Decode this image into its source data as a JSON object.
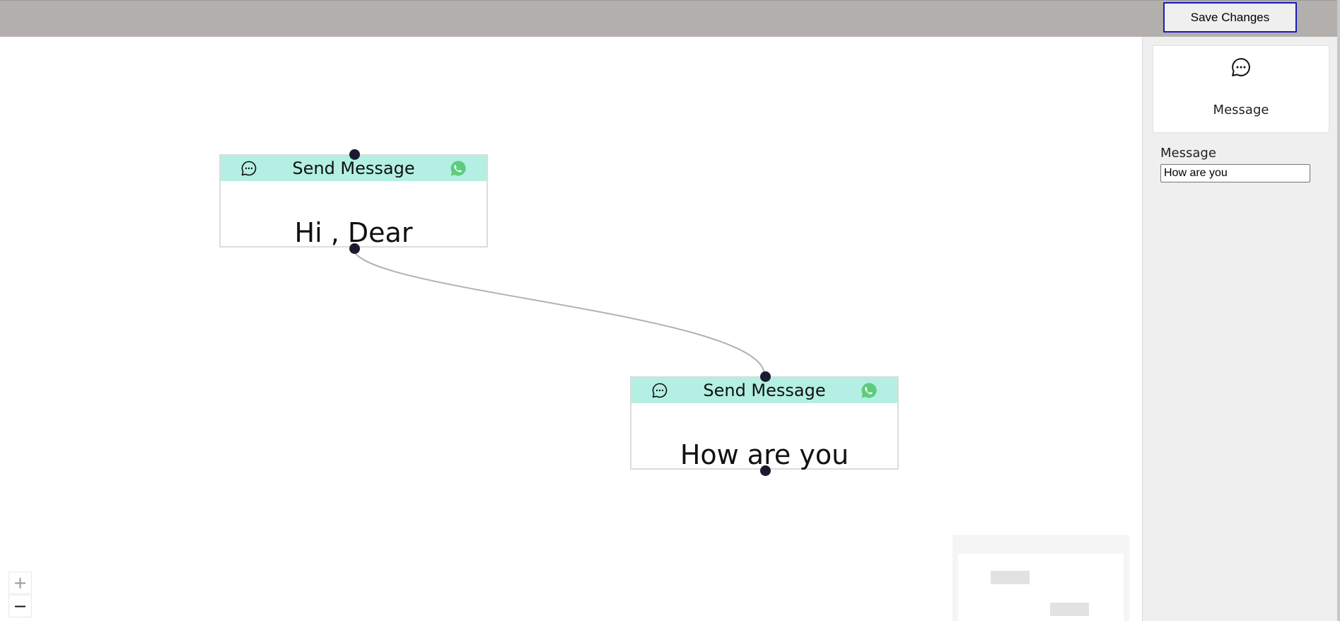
{
  "toolbar": {
    "save_label": "Save Changes"
  },
  "canvas": {
    "nodes": [
      {
        "title": "Send Message",
        "text": "Hi , Dear",
        "icon": "chat-bubble-icon",
        "channel_icon": "whatsapp-icon"
      },
      {
        "title": "Send Message",
        "text": "How are you",
        "icon": "chat-bubble-icon",
        "channel_icon": "whatsapp-icon"
      }
    ],
    "controls": {
      "zoom_in": "+",
      "zoom_out": "−"
    }
  },
  "settings_panel": {
    "node_type": {
      "label": "Message",
      "icon": "chat-bubble-icon"
    },
    "message_field": {
      "label": "Message",
      "value": "How are you"
    }
  },
  "colors": {
    "topbar": "#b3afad",
    "node_header": "#b3efe3",
    "whatsapp": "#5ccc7e",
    "handle": "#1b1a2e",
    "edge": "#b1b1b7",
    "button_border": "#1c1cb8"
  }
}
